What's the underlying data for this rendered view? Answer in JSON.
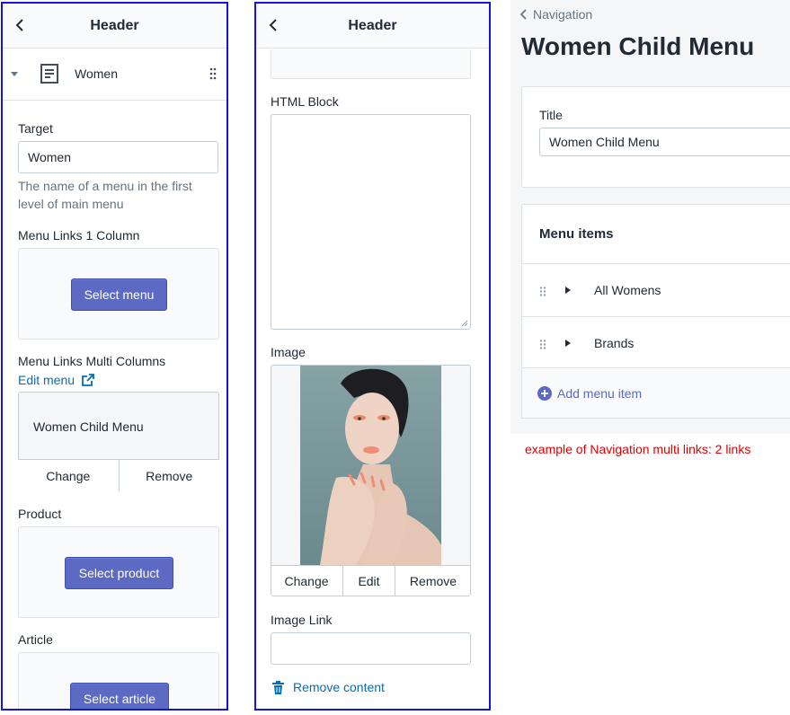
{
  "left_panel": {
    "header_title": "Header",
    "section": {
      "icon": "text-page-icon",
      "title": "Women"
    },
    "target": {
      "label": "Target",
      "value": "Women",
      "help": "The name of a menu in the first level of main menu"
    },
    "menu_links_1": {
      "label": "Menu Links 1 Column",
      "button": "Select menu"
    },
    "menu_links_multi": {
      "label": "Menu Links Multi Columns",
      "edit_link": "Edit menu",
      "selected_menu": "Women Child Menu",
      "change": "Change",
      "remove": "Remove"
    },
    "product": {
      "label": "Product",
      "button": "Select product"
    },
    "article": {
      "label": "Article",
      "button": "Select article"
    }
  },
  "mid_panel": {
    "header_title": "Header",
    "html_block": {
      "label": "HTML Block",
      "value": ""
    },
    "image": {
      "label": "Image",
      "change": "Change",
      "edit": "Edit",
      "remove": "Remove"
    },
    "image_link": {
      "label": "Image Link",
      "value": ""
    },
    "remove_content": "Remove content"
  },
  "navigation": {
    "breadcrumb": "Navigation",
    "page_title": "Women Child Menu",
    "title_field": {
      "label": "Title",
      "value": "Women Child Menu"
    },
    "menu_items_heading": "Menu items",
    "items": [
      {
        "label": "All Womens"
      },
      {
        "label": "Brands"
      }
    ],
    "add_item": "Add menu item"
  },
  "caption": "example of Navigation multi links: 2 links",
  "colors": {
    "panel_border": "#1414e0",
    "primary_button": "#5c6ac4",
    "link": "#006fbb",
    "caption": "#e00000"
  }
}
